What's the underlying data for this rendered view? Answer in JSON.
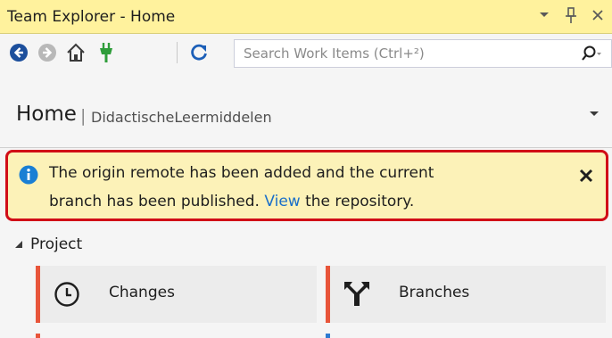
{
  "window": {
    "title": "Team Explorer - Home"
  },
  "toolbar": {
    "search_placeholder": "Search Work Items (Ctrl+²)",
    "icons": [
      "back-arrow-icon",
      "forward-arrow-icon",
      "home-icon",
      "connect-plug-icon",
      "refresh-icon",
      "search-icon"
    ]
  },
  "header": {
    "title": "Home",
    "separator": "|",
    "subtitle": "DidactischeLeermiddelen"
  },
  "banner": {
    "text_before": "The origin remote has been added and the current",
    "text_line2_before": "branch has been published. ",
    "link": "View",
    "text_after": " the repository."
  },
  "project": {
    "section_label": "Project",
    "tiles": [
      {
        "label": "Changes",
        "icon": "clock-icon"
      },
      {
        "label": "Branches",
        "icon": "branch-merge-icon"
      }
    ]
  },
  "colors": {
    "titlebar": "#fff29d",
    "accent_red": "#e8553a",
    "banner_bg": "#fcf2b8",
    "banner_border": "#d10d17",
    "link": "#1a6fc9",
    "info_blue": "#1a7fd4"
  }
}
